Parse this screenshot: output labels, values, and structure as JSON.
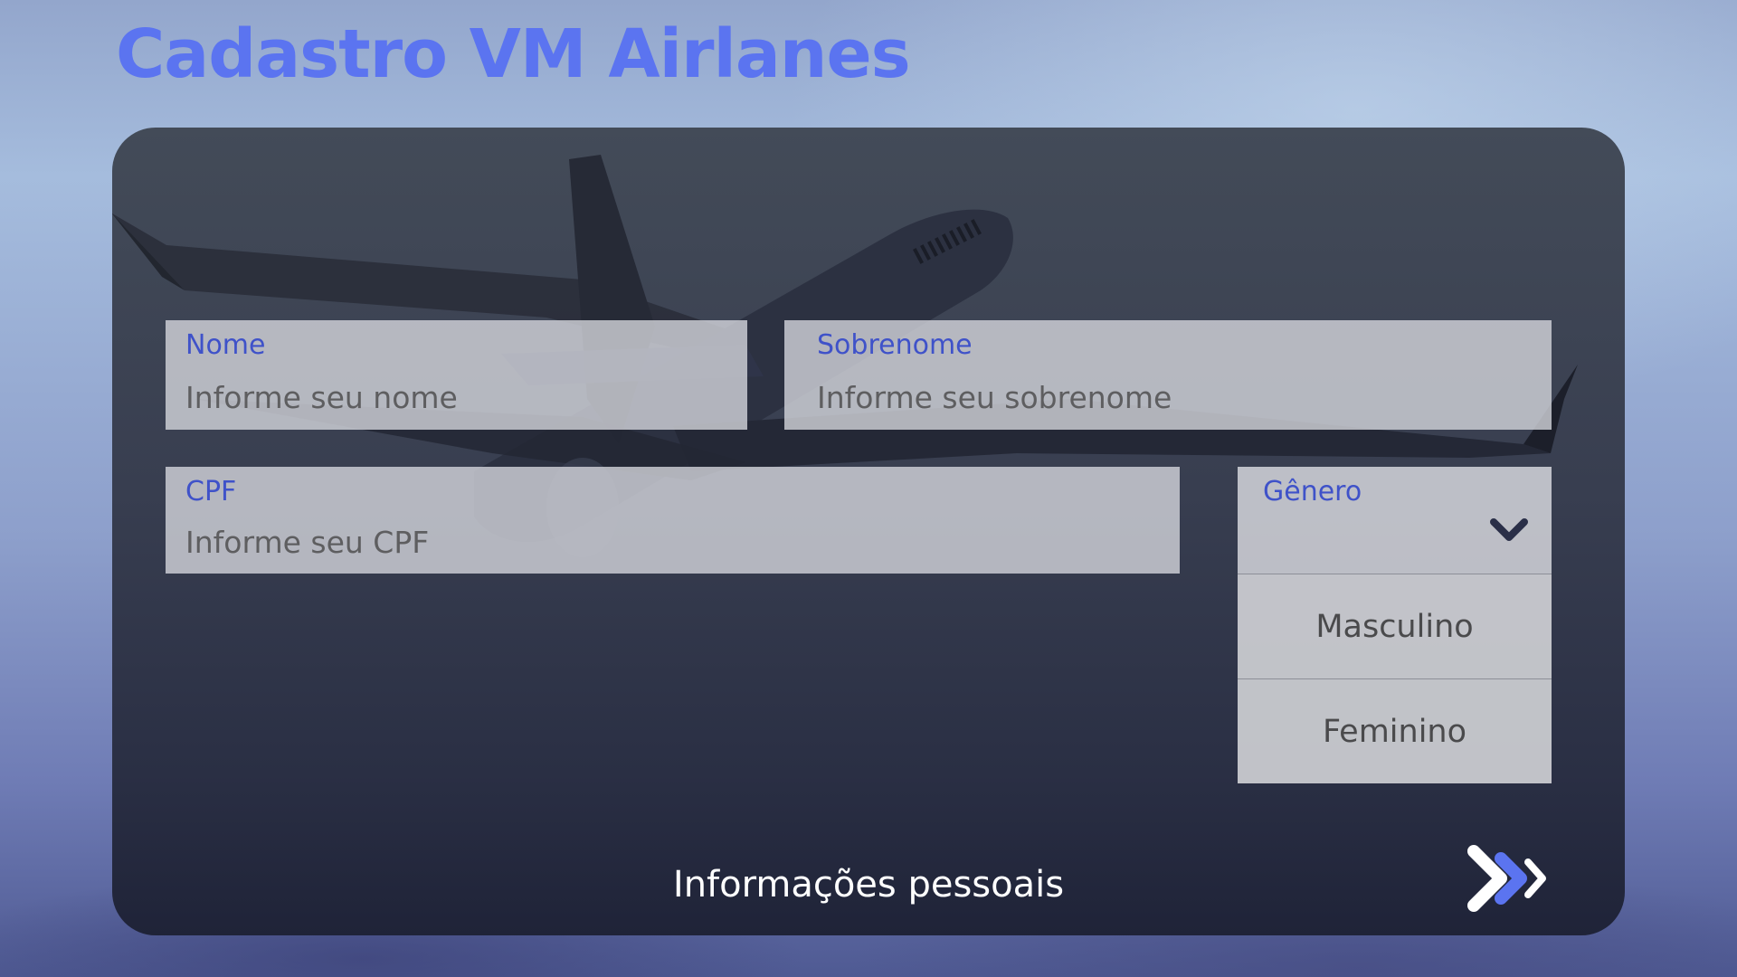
{
  "page": {
    "title": "Cadastro VM Airlanes",
    "colors": {
      "title": "#5b74f0",
      "label": "#3f52c9",
      "panel": "#383e50",
      "next_accent": "#5b74f0"
    }
  },
  "form": {
    "nome": {
      "label": "Nome",
      "placeholder": "Informe seu nome"
    },
    "sobrenome": {
      "label": "Sobrenome",
      "placeholder": "Informe seu sobrenome"
    },
    "cpf": {
      "label": "CPF",
      "placeholder": "Informe seu CPF"
    },
    "genero": {
      "label": "Gênero",
      "icon": "chevron-down-icon",
      "options": [
        "Masculino",
        "Feminino"
      ]
    }
  },
  "footer": {
    "section_caption": "Informações pessoais",
    "next_icon": "double-chevron-right-icon"
  }
}
